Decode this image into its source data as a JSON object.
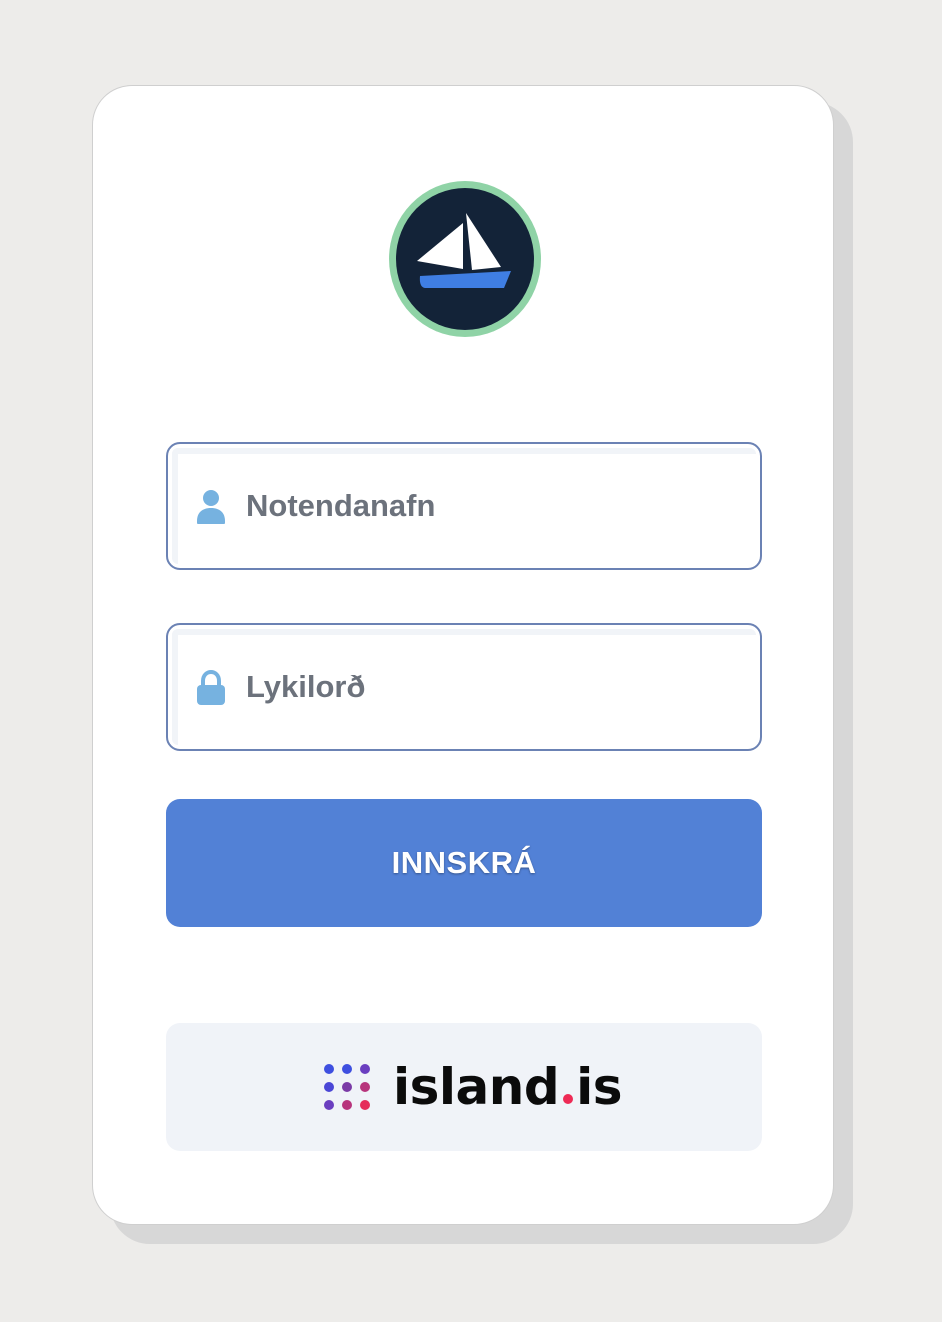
{
  "login": {
    "logo_icon": "sailboat-logo-icon",
    "username": {
      "icon": "user-icon",
      "placeholder": "Notendanafn",
      "value": ""
    },
    "password": {
      "icon": "lock-icon",
      "placeholder": "Lykilorð",
      "value": ""
    },
    "submit_label": "INNSKRÁ",
    "island_login": {
      "icon": "island-dots-icon",
      "text_left": "island",
      "text_right": "is"
    }
  },
  "colors": {
    "background": "#edecea",
    "card": "#ffffff",
    "logo_ring": "#8fd3a6",
    "logo_fill": "#132338",
    "boat_hull": "#3f7ee3",
    "field_border": "#6b82b4",
    "field_icon": "#76b2e0",
    "button_primary": "#5281d6",
    "island_button_bg": "#f0f3f8",
    "island_dot_red": "#ee2a55"
  }
}
